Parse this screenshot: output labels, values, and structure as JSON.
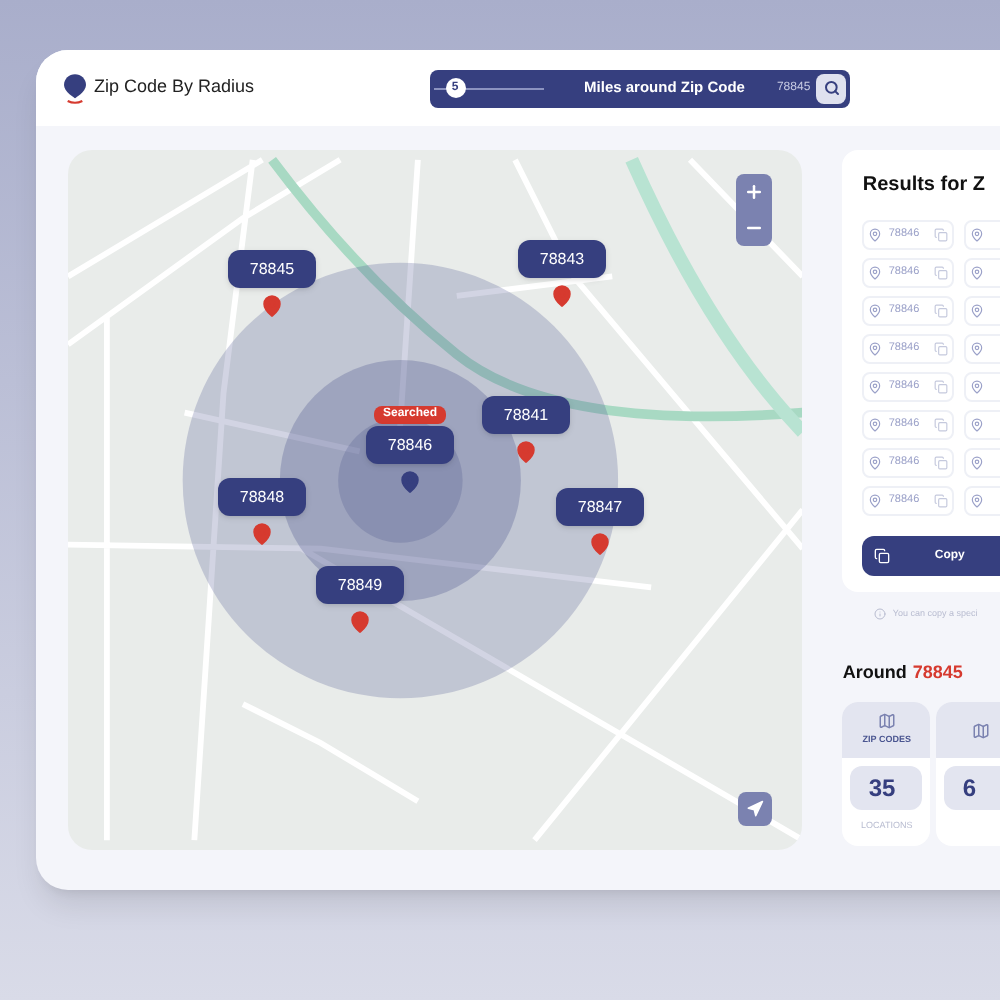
{
  "app": {
    "title": "Zip Code By Radius"
  },
  "search_bar": {
    "slider_value": "5",
    "level": 0.1,
    "label": "Miles around Zip Code",
    "zip_value": "78845"
  },
  "map": {
    "markers": [
      {
        "zip": "78845",
        "searched": false
      },
      {
        "zip": "78843",
        "searched": false
      },
      {
        "zip": "78846",
        "searched": true,
        "badge": "Searched"
      },
      {
        "zip": "78841",
        "searched": false
      },
      {
        "zip": "78848",
        "searched": false
      },
      {
        "zip": "78847",
        "searched": false
      },
      {
        "zip": "78849",
        "searched": false
      }
    ]
  },
  "results": {
    "title": "Results for Z",
    "rows": [
      "78846",
      "78846",
      "78846",
      "78846",
      "78846",
      "78846",
      "78846",
      "78846"
    ],
    "copy_button": "Copy",
    "hint": "You can copy a speci"
  },
  "around": {
    "label": "Around",
    "zip": "78845"
  },
  "stats": [
    {
      "label": "ZIP CODES",
      "value": "35",
      "footer": "LOCATIONS"
    },
    {
      "value": "6"
    }
  ]
}
